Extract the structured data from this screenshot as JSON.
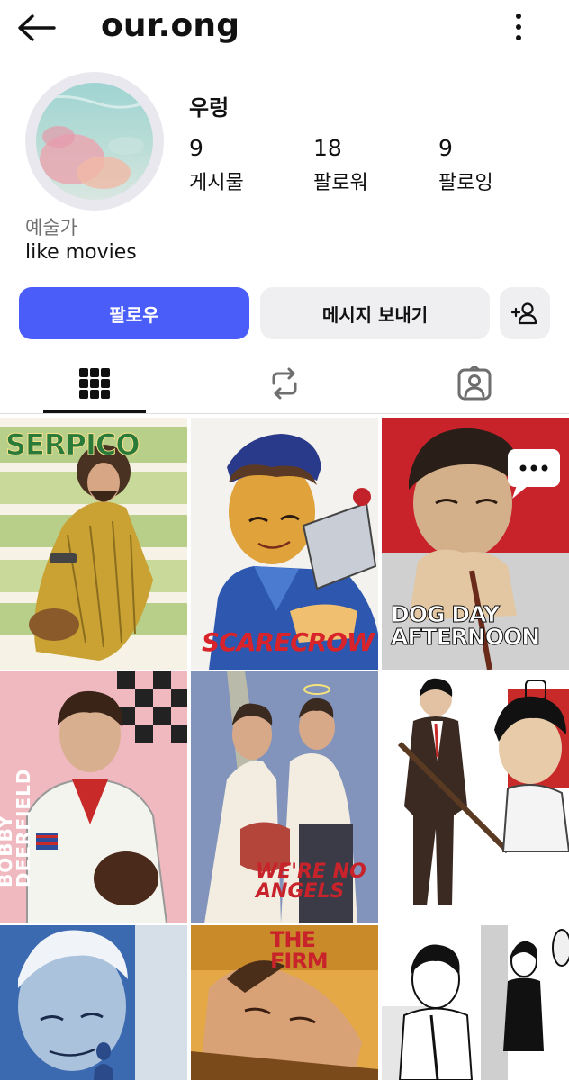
{
  "header": {
    "username": "our.ong",
    "back_icon": "arrow-left-icon",
    "more_icon": "more-vertical-icon"
  },
  "profile": {
    "display_name": "우렁",
    "category": "예술가",
    "bio": "like movies",
    "stats": [
      {
        "value": "9",
        "label": "게시물"
      },
      {
        "value": "18",
        "label": "팔로워"
      },
      {
        "value": "9",
        "label": "팔로잉"
      }
    ]
  },
  "actions": {
    "follow_label": "팔로우",
    "message_label": "메시지 보내기",
    "add_icon": "add-person-icon"
  },
  "tabs": [
    {
      "icon": "grid-icon",
      "selected": true
    },
    {
      "icon": "reels-repost-icon",
      "selected": false
    },
    {
      "icon": "tagged-person-icon",
      "selected": false
    }
  ],
  "posts": [
    {
      "caption": "SERPICO"
    },
    {
      "caption": "SCARECROW"
    },
    {
      "caption": "DOG DAY AFTERNOON"
    },
    {
      "caption": "BOBBY DEERFIELD"
    },
    {
      "caption": "WE'RE NO ANGELS"
    },
    {
      "caption": ""
    },
    {
      "caption": ""
    },
    {
      "caption": "THE FIRM"
    },
    {
      "caption": ""
    }
  ],
  "colors": {
    "accent": "#4a5df9",
    "button_gray": "#efeff2",
    "text_secondary": "#6f6f6f"
  }
}
